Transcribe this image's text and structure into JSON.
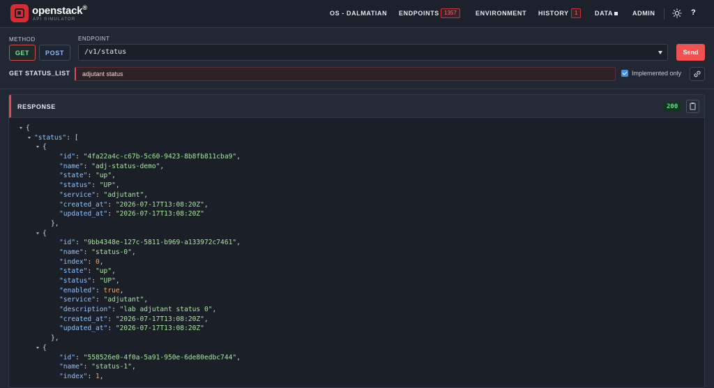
{
  "header": {
    "brand": "openstack",
    "brand_mark": "®",
    "brand_sub": "API SIMULATOR",
    "nav": {
      "cloud": "OS - DALMATIAN",
      "endpoints": "ENDPOINTS",
      "endpoints_count": "1357",
      "environment": "ENVIRONMENT",
      "history": "HISTORY",
      "history_count": "1",
      "data": "DATA",
      "admin": "ADMIN",
      "help": "?"
    }
  },
  "request": {
    "method_label": "METHOD",
    "endpoint_label": "ENDPOINT",
    "methods": [
      "GET",
      "POST"
    ],
    "selected_method": "GET",
    "endpoint": "/v1/status",
    "send_label": "Send",
    "operation": "GET STATUS_LIST",
    "search_value": "adjutant status",
    "implemented_only_label": "Implemented only",
    "implemented_only": true
  },
  "response": {
    "title": "RESPONSE",
    "status_code": "200",
    "json_lines": [
      "{",
      "\"status\": [",
      "{",
      "\"id\": \"4fa22a4c-c67b-5c60-9423-8b8fb811cba9\",",
      "\"name\": \"adj-status-demo\",",
      "\"state\": \"up\",",
      "\"status\": \"UP\",",
      "\"service\": \"adjutant\",",
      "\"created_at\": \"2026-07-17T13:08:20Z\",",
      "\"updated_at\": \"2026-07-17T13:08:20Z\"",
      "},",
      "{",
      "\"id\": \"9bb4348e-127c-5811-b969-a133972c7461\",",
      "\"name\": \"status-0\",",
      "\"index\": 0,",
      "\"state\": \"up\",",
      "\"status\": \"UP\",",
      "\"enabled\": true,",
      "\"service\": \"adjutant\",",
      "\"description\": \"lab adjutant status 0\",",
      "\"created_at\": \"2026-07-17T13:08:20Z\",",
      "\"updated_at\": \"2026-07-17T13:08:20Z\"",
      "},",
      "{",
      "\"id\": \"558526e0-4f0a-5a91-950e-6de80edbc744\",",
      "\"name\": \"status-1\",",
      "\"index\": 1,"
    ]
  }
}
